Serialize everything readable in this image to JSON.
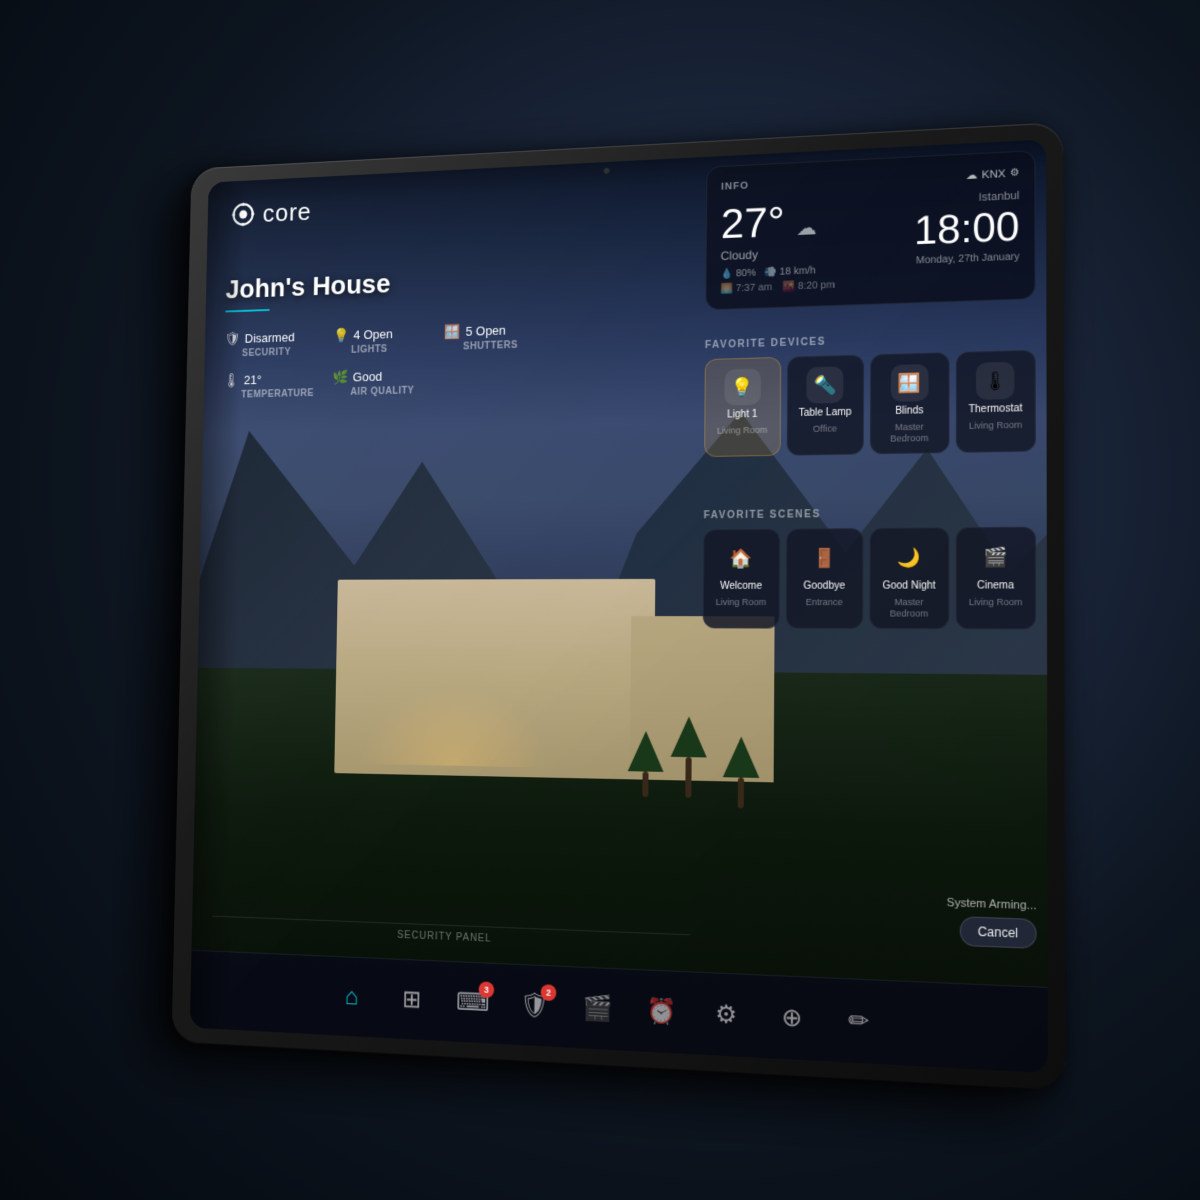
{
  "app": {
    "name": "core",
    "logo_alt": "Core Smart Home"
  },
  "home": {
    "title": "John's House",
    "accent_color": "#00bcd4"
  },
  "status": {
    "security": {
      "icon": "🛡",
      "value": "Disarmed",
      "label": "SECURITY"
    },
    "lights": {
      "icon": "💡",
      "value": "4 Open",
      "label": "LIGHTS"
    },
    "shutters": {
      "icon": "🪟",
      "value": "5 Open",
      "label": "SHUTTERS"
    },
    "temperature": {
      "icon": "🌡",
      "value": "21°",
      "label": "TEMPERATURE"
    },
    "air_quality": {
      "icon": "🌿",
      "value": "Good",
      "label": "AIR QUALITY"
    }
  },
  "info_panel": {
    "label": "INFO",
    "knx_label": "KNX",
    "city": "Istanbul",
    "temperature": "27°",
    "weather_desc": "Cloudy",
    "humidity": "80%",
    "wind": "18 km/h",
    "sunrise": "7:37 am",
    "sunset": "8:20 pm",
    "time": "18:00",
    "date": "Monday, 27th January"
  },
  "favorite_devices": {
    "title": "FAVORITE DEVICES",
    "items": [
      {
        "name": "Light 1",
        "location": "Living Room",
        "icon": "💡",
        "active": true
      },
      {
        "name": "Table Lamp",
        "location": "Office",
        "icon": "🔦",
        "active": false
      },
      {
        "name": "Blinds",
        "location": "Master Bedroom",
        "icon": "🪟",
        "active": false
      },
      {
        "name": "Thermostat",
        "location": "Living Room",
        "icon": "🌡",
        "active": false
      }
    ]
  },
  "favorite_scenes": {
    "title": "FAVORITE SCENES",
    "items": [
      {
        "name": "Welcome",
        "location": "Living Room",
        "icon": "🏠"
      },
      {
        "name": "Goodbye",
        "location": "Entrance",
        "icon": "🚪"
      },
      {
        "name": "Good Night",
        "location": "Master Bedroom",
        "icon": "🌙"
      },
      {
        "name": "Cinema",
        "location": "Living Room",
        "icon": "🎬"
      }
    ]
  },
  "system_arming": {
    "text": "System Arming...",
    "cancel_label": "Cancel"
  },
  "security_panel": {
    "label": "SECURITY PANEL"
  },
  "bottom_nav": {
    "items": [
      {
        "id": "home",
        "icon": "⌂",
        "active": true,
        "badge": null
      },
      {
        "id": "grid",
        "icon": "⊞",
        "active": false,
        "badge": null
      },
      {
        "id": "keypad",
        "icon": "⌨",
        "active": false,
        "badge": "3"
      },
      {
        "id": "security",
        "icon": "🛡",
        "active": false,
        "badge": "2"
      },
      {
        "id": "video",
        "icon": "🎬",
        "active": false,
        "badge": null
      },
      {
        "id": "clock",
        "icon": "⏰",
        "active": false,
        "badge": null
      },
      {
        "id": "settings",
        "icon": "⚙",
        "active": false,
        "badge": null
      },
      {
        "id": "channels",
        "icon": "⊕",
        "active": false,
        "badge": null
      },
      {
        "id": "edit",
        "icon": "✏",
        "active": false,
        "badge": null
      }
    ]
  }
}
